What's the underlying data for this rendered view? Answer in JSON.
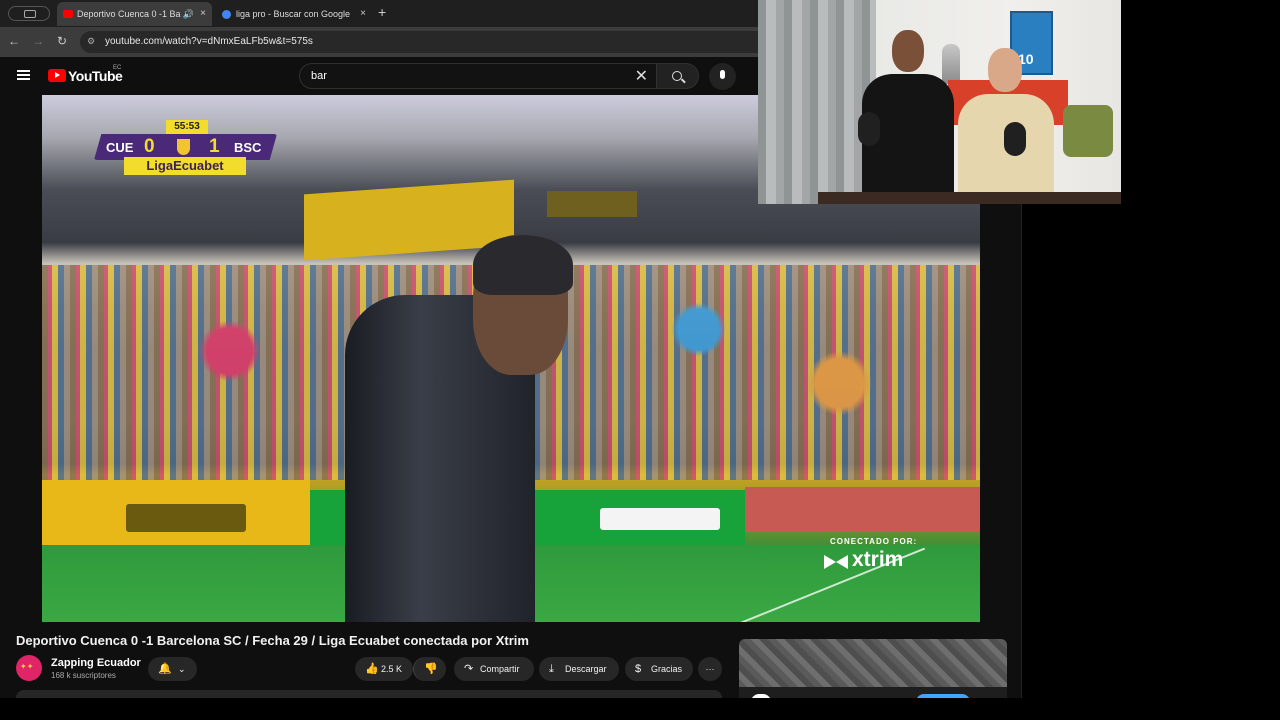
{
  "browser": {
    "tabs": [
      {
        "title": "Deportivo Cuenca 0 -1 Ba",
        "active": true,
        "favicon_color": "#ff0000"
      },
      {
        "title": "liga pro - Buscar con Google",
        "active": false,
        "favicon_color": "#4285f4"
      }
    ],
    "new_tab_symbol": "+",
    "close_symbol": "×",
    "url": "youtube.com/watch?v=dNmxEaLFb5w&t=575s"
  },
  "youtube": {
    "logo_text": "YouTube",
    "country_code": "EC",
    "search_value": "bar",
    "clear_symbol": "✕"
  },
  "video": {
    "scorebug": {
      "time": "55:53",
      "home": "CUE",
      "home_score": "0",
      "away": "BSC",
      "away_score": "1",
      "league": "LigaEcuabet"
    },
    "sponsor_tag": "CONECTADO POR:",
    "sponsor": "xtrim",
    "title": "Deportivo Cuenca 0 -1 Barcelona SC / Fecha 29 / Liga Ecuabet conectada por Xtrim"
  },
  "channel": {
    "name": "Zapping Ecuador",
    "subscribers": "168 k suscriptores"
  },
  "actions": {
    "likes": "2.5 K",
    "share": "Compartir",
    "download": "Descargar",
    "thanks": "Gracias",
    "more": "···"
  },
  "webcam": {
    "poster_number": "10"
  },
  "colors": {
    "yt_red": "#ff0000",
    "scorebug_purple": "#4a2a78",
    "scorebug_yellow": "#f2dc2c",
    "link_blue": "#3ea6ff"
  }
}
